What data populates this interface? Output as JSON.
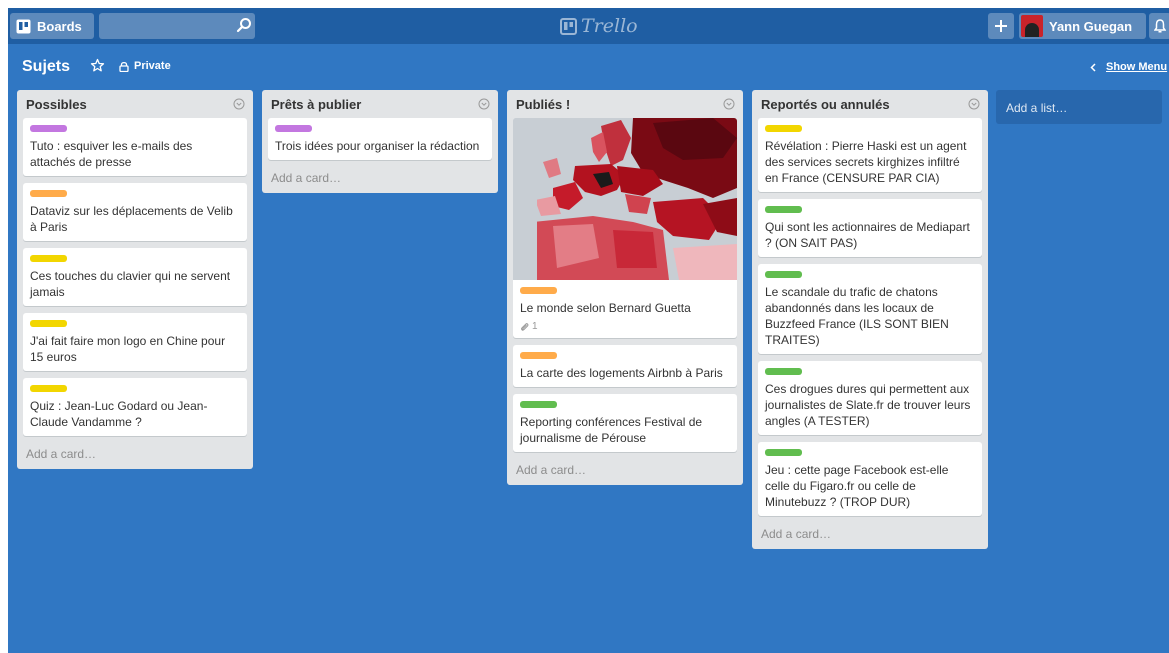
{
  "header": {
    "boards_label": "Boards",
    "search_value": "",
    "logo_text": "Trello",
    "user_name": "Yann Guegan"
  },
  "board": {
    "title": "Sujets",
    "visibility": "Private",
    "show_menu_label": "Show Menu"
  },
  "colors": {
    "purple": "#c377e0",
    "orange": "#ffab4a",
    "yellow": "#f2d600",
    "green": "#61bd4f"
  },
  "lists": [
    {
      "title": "Possibles",
      "add_card_label": "Add a card…",
      "cards": [
        {
          "label_color": "purple",
          "title": "Tuto : esquiver les e-mails des attachés de presse"
        },
        {
          "label_color": "orange",
          "title": "Dataviz sur les déplacements de Velib à Paris"
        },
        {
          "label_color": "yellow",
          "title": "Ces touches du clavier qui ne servent jamais"
        },
        {
          "label_color": "yellow",
          "title": "J'ai fait faire mon logo en Chine pour 15 euros"
        },
        {
          "label_color": "yellow",
          "title": "Quiz : Jean-Luc Godard ou Jean-Claude Vandamme ?"
        }
      ]
    },
    {
      "title": "Prêts à publier",
      "add_card_label": "Add a card…",
      "cards": [
        {
          "label_color": "purple",
          "title": "Trois idées pour organiser la rédaction"
        }
      ]
    },
    {
      "title": "Publiés !",
      "add_card_label": "Add a card…",
      "cards": [
        {
          "label_color": "orange",
          "title": "Le monde selon Bernard Guetta",
          "attachments": "1",
          "has_cover": true
        },
        {
          "label_color": "orange",
          "title": "La carte des logements Airbnb à Paris"
        },
        {
          "label_color": "green",
          "title": "Reporting conférences Festival de journalisme de Pérouse"
        }
      ]
    },
    {
      "title": "Reportés ou annulés",
      "add_card_label": "Add a card…",
      "cards": [
        {
          "label_color": "yellow",
          "title": "Révélation : Pierre Haski est un agent des services secrets kirghizes infiltré en France (CENSURE PAR CIA)"
        },
        {
          "label_color": "green",
          "title": "Qui sont les actionnaires de Mediapart ? (ON SAIT PAS)"
        },
        {
          "label_color": "green",
          "title": "Le scandale du trafic de chatons abandonnés dans les locaux de Buzzfeed France (ILS SONT BIEN TRAITES)"
        },
        {
          "label_color": "green",
          "title": "Ces drogues dures qui permettent aux journalistes de Slate.fr de trouver leurs angles (A TESTER)"
        },
        {
          "label_color": "green",
          "title": "Jeu : cette page Facebook est-elle celle du Figaro.fr ou celle de Minutebuzz ? (TROP DUR)"
        }
      ]
    }
  ],
  "add_list_label": "Add a list…"
}
